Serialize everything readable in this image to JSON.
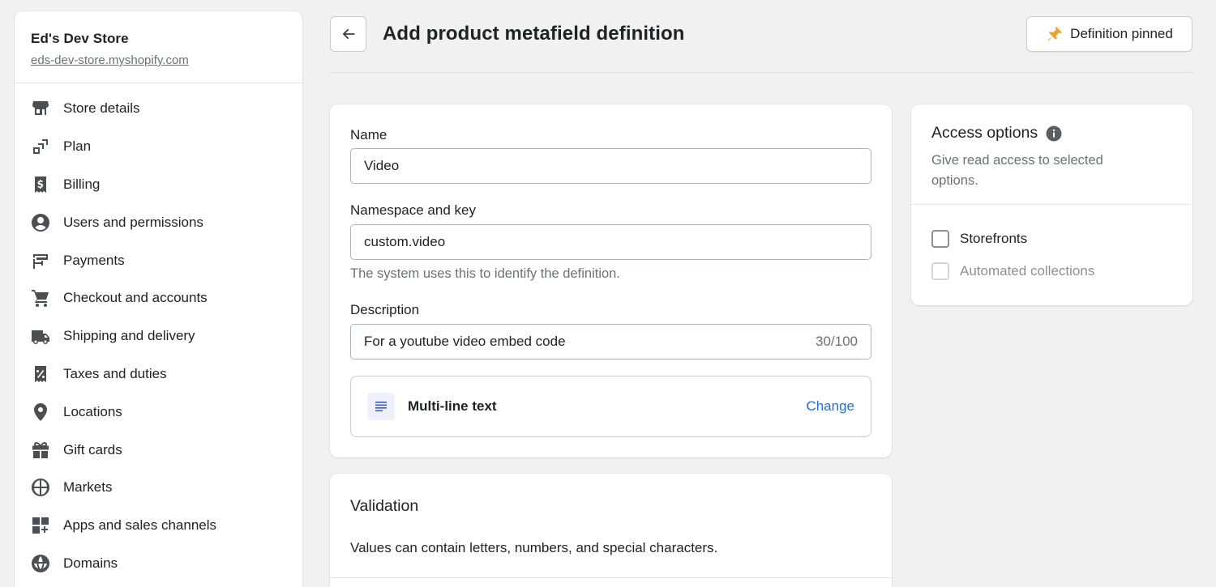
{
  "sidebar": {
    "store_name": "Ed's Dev Store",
    "store_url": "eds-dev-store.myshopify.com",
    "items": [
      {
        "label": "Store details",
        "icon": "store-icon"
      },
      {
        "label": "Plan",
        "icon": "plan-icon"
      },
      {
        "label": "Billing",
        "icon": "billing-icon"
      },
      {
        "label": "Users and permissions",
        "icon": "user-icon"
      },
      {
        "label": "Payments",
        "icon": "payments-icon"
      },
      {
        "label": "Checkout and accounts",
        "icon": "cart-icon"
      },
      {
        "label": "Shipping and delivery",
        "icon": "truck-icon"
      },
      {
        "label": "Taxes and duties",
        "icon": "tax-icon"
      },
      {
        "label": "Locations",
        "icon": "location-pin-icon"
      },
      {
        "label": "Gift cards",
        "icon": "gift-icon"
      },
      {
        "label": "Markets",
        "icon": "markets-globe-icon"
      },
      {
        "label": "Apps and sales channels",
        "icon": "apps-icon"
      },
      {
        "label": "Domains",
        "icon": "domains-globe-icon"
      }
    ]
  },
  "header": {
    "title": "Add product metafield definition",
    "pin_label": "Definition pinned"
  },
  "form": {
    "name_label": "Name",
    "name_value": "Video",
    "namespace_label": "Namespace and key",
    "namespace_value": "custom.video",
    "namespace_help": "The system uses this to identify the definition.",
    "description_label": "Description",
    "description_value": "For a youtube video embed code",
    "description_counter": "30/100",
    "type_label": "Multi-line text",
    "type_change": "Change"
  },
  "access": {
    "title": "Access options",
    "description": "Give read access to selected options.",
    "options": [
      {
        "label": "Storefronts",
        "checked": false,
        "disabled": false
      },
      {
        "label": "Automated collections",
        "checked": false,
        "disabled": true
      }
    ]
  },
  "validation": {
    "title": "Validation",
    "text": "Values can contain letters, numbers, and special characters."
  },
  "colors": {
    "link": "#2c6ecb",
    "pin": "#e8a32d",
    "background": "#f1f1f1"
  }
}
